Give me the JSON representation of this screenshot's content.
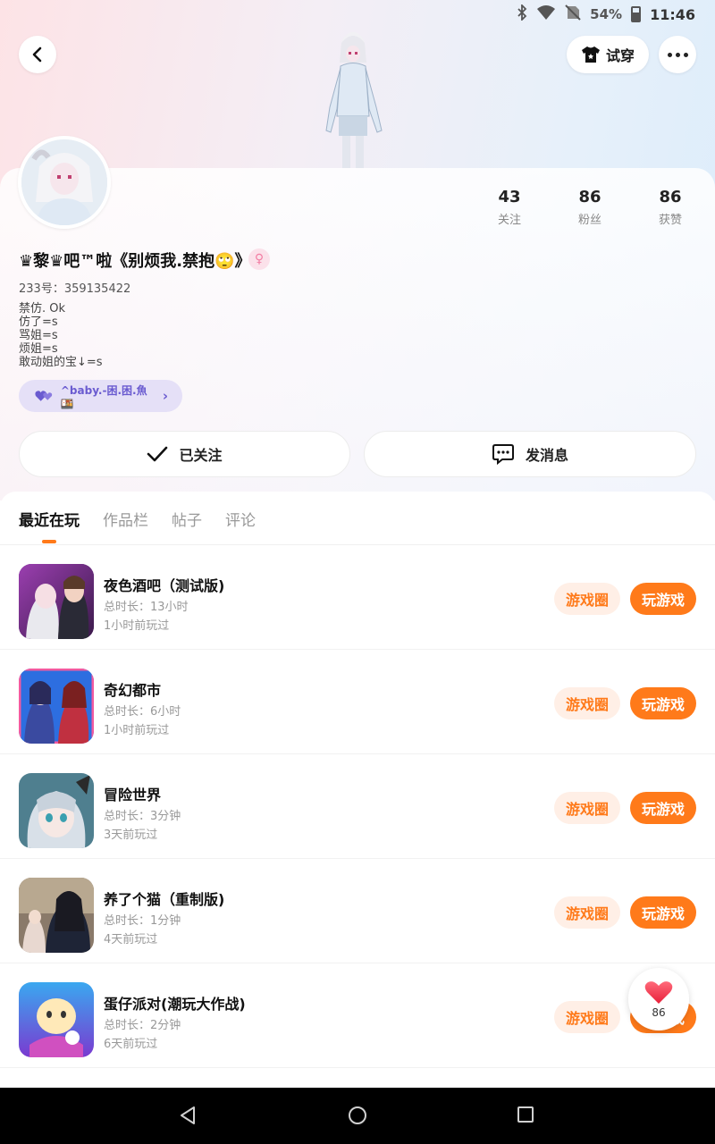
{
  "status_bar": {
    "battery_percent": "54%",
    "time": "11:46"
  },
  "header": {
    "tryon_label": "试穿"
  },
  "profile": {
    "stats": [
      {
        "value": "43",
        "label": "关注"
      },
      {
        "value": "86",
        "label": "粉丝"
      },
      {
        "value": "86",
        "label": "获赞"
      }
    ],
    "nickname": "♛黎♛吧™啦《别烦我.禁抱🙄》",
    "gender_symbol": "♀",
    "uid": "233号：359135422",
    "bio_lines": [
      "禁仿. Ok",
      "仿了=s",
      "骂姐=s",
      "烦姐=s",
      "敢动姐的宝↓=s"
    ],
    "fan_tag": "^baby.-困.困.魚🍱",
    "follow_label": "已关注",
    "message_label": "发消息"
  },
  "tabs": [
    {
      "label": "最近在玩",
      "active": true
    },
    {
      "label": "作品栏",
      "active": false
    },
    {
      "label": "帖子",
      "active": false
    },
    {
      "label": "评论",
      "active": false
    }
  ],
  "games": [
    {
      "title": "夜色酒吧（测试版)",
      "duration": "总时长：13小时",
      "last_played": "1小时前玩过",
      "circle_label": "游戏圈",
      "play_label": "玩游戏",
      "icon": "game-icon-nightbar"
    },
    {
      "title": "奇幻都市",
      "duration": "总时长：6小时",
      "last_played": "1小时前玩过",
      "circle_label": "游戏圈",
      "play_label": "玩游戏",
      "icon": "game-icon-fantasy-city"
    },
    {
      "title": "冒险世界",
      "duration": "总时长：3分钟",
      "last_played": "3天前玩过",
      "circle_label": "游戏圈",
      "play_label": "玩游戏",
      "icon": "game-icon-adventure"
    },
    {
      "title": "养了个猫（重制版)",
      "duration": "总时长：1分钟",
      "last_played": "4天前玩过",
      "circle_label": "游戏圈",
      "play_label": "玩游戏",
      "icon": "game-icon-cat"
    },
    {
      "title": "蛋仔派对(潮玩大作战)",
      "duration": "总时长：2分钟",
      "last_played": "6天前玩过",
      "circle_label": "游戏圈",
      "play_label": "玩游戏",
      "icon": "game-icon-eggy"
    }
  ],
  "like_float": {
    "count": "86"
  },
  "colors": {
    "accent": "#ff7a1a",
    "accent_soft": "#ffefe6",
    "fan_tag_bg": "#e5e0f7"
  }
}
